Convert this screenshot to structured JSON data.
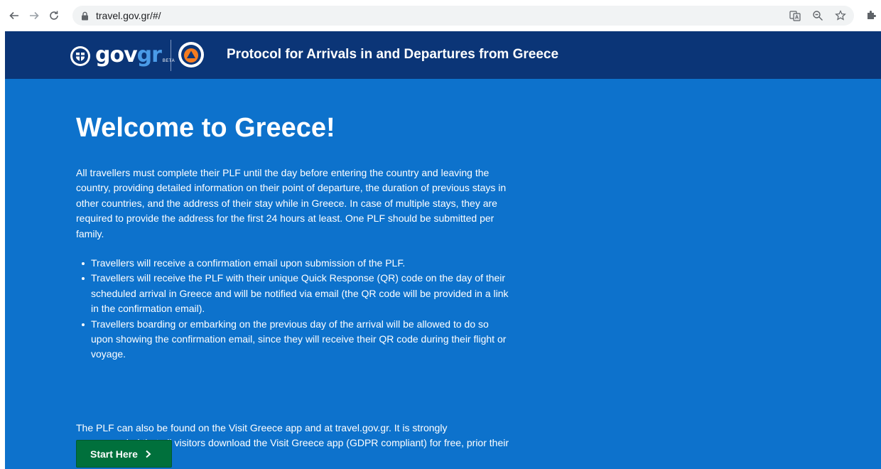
{
  "browser": {
    "url": "travel.gov.gr/#/"
  },
  "header": {
    "logo_gov": "gov",
    "logo_gr": "gr",
    "logo_beta": "BETA",
    "title": "Protocol for Arrivals in and Departures from Greece"
  },
  "main": {
    "heading": "Welcome to Greece!",
    "intro": "All travellers must complete their PLF until the day before entering the country and leaving the country, providing detailed information on their point of departure, the duration of previous stays in other countries, and the address of their stay while in Greece. In case of multiple stays, they are required to provide the address for the first 24 hours at least. One PLF should be submitted per family.",
    "bullets": [
      "Travellers will receive a confirmation email upon submission of the PLF.",
      "Travellers will receive the PLF with their unique Quick Response (QR) code on the day of their scheduled arrival in Greece and will be notified via email (the QR code will be provided in a link in the confirmation email).",
      "Travellers boarding or embarking on the previous day of the arrival will be allowed to do so upon showing the confirmation email, since they will receive their QR code during their flight or voyage."
    ],
    "outro": "The PLF can also be found on the Visit Greece app and at travel.gov.gr. It is strongly recommended that all visitors download the Visit Greece app (GDPR compliant) for free, prior their arrival in Greece.",
    "start_button": "Start Here"
  },
  "colors": {
    "header_bg": "#0b3577",
    "main_bg": "#0d72cc",
    "button_bg": "#00703c",
    "logo_accent": "#4a9be8"
  }
}
